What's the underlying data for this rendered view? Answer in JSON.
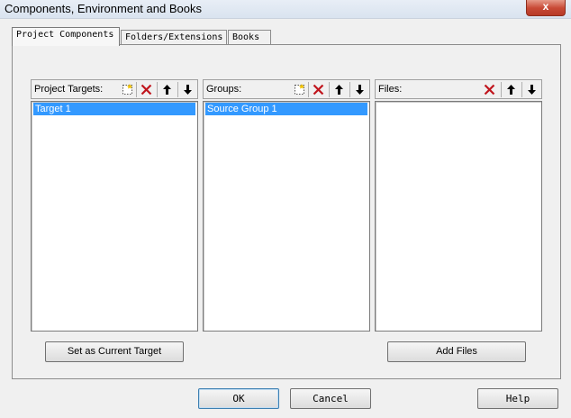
{
  "window": {
    "title": "Components, Environment and Books",
    "close_symbol": "x"
  },
  "tabs": [
    {
      "label": "Project Components",
      "active": true
    },
    {
      "label": "Folders/Extensions",
      "active": false
    },
    {
      "label": "Books",
      "active": false
    }
  ],
  "panels": {
    "targets": {
      "label": "Project Targets:",
      "items": [
        "Target 1"
      ],
      "selected_index": 0,
      "action_button": "Set as Current Target",
      "icons": [
        "new-item-icon",
        "delete-icon",
        "move-up-icon",
        "move-down-icon"
      ]
    },
    "groups": {
      "label": "Groups:",
      "items": [
        "Source Group 1"
      ],
      "selected_index": 0,
      "icons": [
        "new-item-icon",
        "delete-icon",
        "move-up-icon",
        "move-down-icon"
      ]
    },
    "files": {
      "label": "Files:",
      "items": [],
      "action_button": "Add Files",
      "icons": [
        "delete-icon",
        "move-up-icon",
        "move-down-icon"
      ]
    }
  },
  "footer": {
    "ok": "OK",
    "cancel": "Cancel",
    "help": "Help"
  },
  "colors": {
    "selection": "#3399ff",
    "delete_icon": "#c0141c"
  }
}
